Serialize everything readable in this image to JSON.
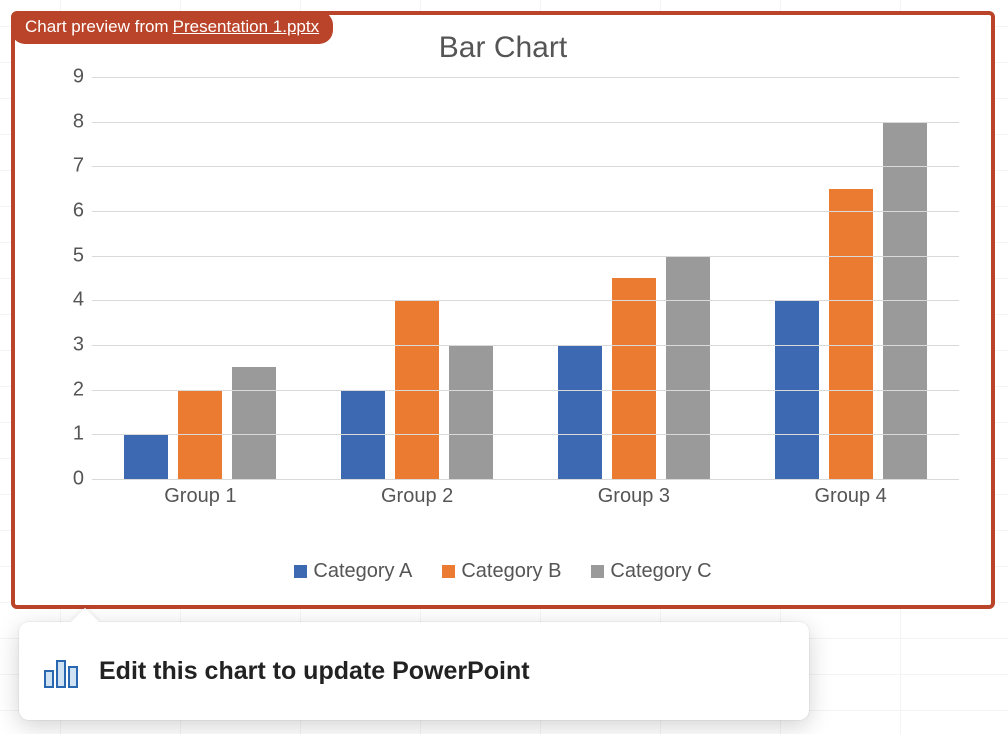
{
  "badge": {
    "prefix": "Chart preview from ",
    "filename": "Presentation 1.pptx"
  },
  "tooltip": {
    "text": "Edit this chart to update PowerPoint"
  },
  "chart_data": {
    "type": "bar",
    "title": "Bar Chart",
    "categories": [
      "Group 1",
      "Group 2",
      "Group 3",
      "Group 4"
    ],
    "series": [
      {
        "name": "Category A",
        "values": [
          1,
          2,
          3,
          4
        ],
        "color": "#3d69b3"
      },
      {
        "name": "Category B",
        "values": [
          2,
          4,
          4.5,
          6.5
        ],
        "color": "#ea7b31"
      },
      {
        "name": "Category C",
        "values": [
          2.5,
          3,
          5,
          8
        ],
        "color": "#9a9a9a"
      }
    ],
    "y_ticks": [
      0,
      1,
      2,
      3,
      4,
      5,
      6,
      7,
      8,
      9
    ],
    "ylim": [
      0,
      9
    ],
    "xlabel": "",
    "ylabel": ""
  }
}
